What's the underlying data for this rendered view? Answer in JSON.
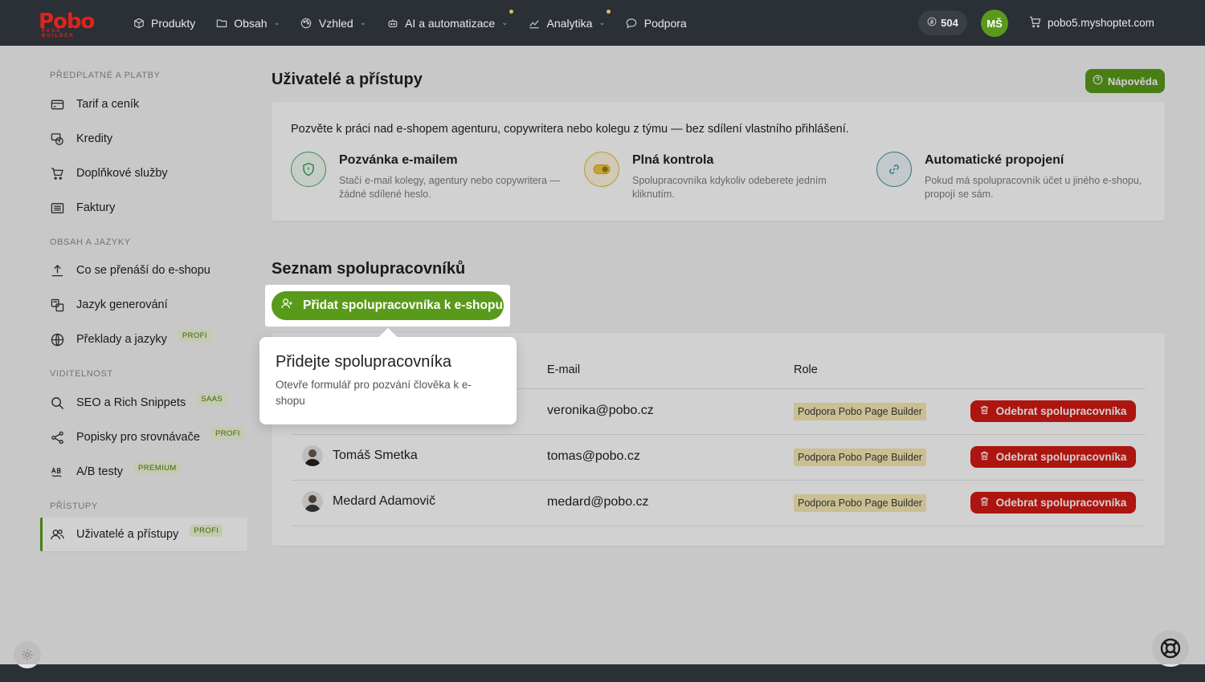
{
  "brand": {
    "logo_text": "Pobo",
    "logo_sub": "PAGE BUILDER"
  },
  "nav": {
    "items": [
      {
        "label": "Produkty",
        "icon": "box-icon"
      },
      {
        "label": "Obsah",
        "icon": "folder-icon"
      },
      {
        "label": "Vzhled",
        "icon": "palette-icon"
      },
      {
        "label": "AI a automatizace",
        "icon": "robot-icon"
      },
      {
        "label": "Analytika",
        "icon": "chart-icon"
      },
      {
        "label": "Podpora",
        "icon": "chat-icon"
      }
    ],
    "credits": "504",
    "user_initials": "MŠ",
    "shop": "pobo5.myshoptet.com"
  },
  "sidebar": {
    "sections": [
      {
        "title": "PŘEDPLATNÉ A PLATBY"
      },
      {
        "title": "OBSAH A JAZYKY"
      },
      {
        "title": "VIDITELNOST"
      },
      {
        "title": "PŘÍSTUPY"
      }
    ],
    "items": [
      {
        "label": "Tarif a ceník",
        "icon": "card-icon",
        "badge": ""
      },
      {
        "label": "Kredity",
        "icon": "coins-icon",
        "badge": ""
      },
      {
        "label": "Doplňkové služby",
        "icon": "cart-icon",
        "badge": ""
      },
      {
        "label": "Faktury",
        "icon": "invoice-icon",
        "badge": ""
      },
      {
        "label": "Co se přenáší do e-shopu",
        "icon": "upload-icon",
        "badge": ""
      },
      {
        "label": "Jazyk generování",
        "icon": "translate-icon",
        "badge": ""
      },
      {
        "label": "Překlady a jazyky",
        "icon": "globe-icon",
        "badge": "PROFI"
      },
      {
        "label": "SEO a Rich Snippets",
        "icon": "search-icon",
        "badge": "SAAS"
      },
      {
        "label": "Popisky pro srovnávače",
        "icon": "share-icon",
        "badge": "PROFI"
      },
      {
        "label": "A/B testy",
        "icon": "ab-icon",
        "badge": "PREMIUM"
      },
      {
        "label": "Uživatelé a přístupy",
        "icon": "users-icon",
        "badge": "PROFI"
      }
    ]
  },
  "main": {
    "title": "Uživatelé a přístupy",
    "help_label": "Nápověda",
    "info": {
      "lead": "Pozvěte k práci nad e-shopem agenturu, copywritera nebo kolegu z týmu — bez sdílení vlastního přihlášení.",
      "features": [
        {
          "title": "Pozvánka e-mailem",
          "desc": "Stačí e-mail kolegy, agentury nebo copywritera — žádné sdílené heslo."
        },
        {
          "title": "Plná kontrola",
          "desc": "Spolupracovníka kdykoliv odeberete jedním kliknutím."
        },
        {
          "title": "Automatické propojení",
          "desc": "Pokud má spolupracovník účet u jiného e-shopu, propojí se sám."
        }
      ]
    },
    "list_title": "Seznam spolupracovníků",
    "add_label": "Přidat spolupracovníka k e-shopu",
    "table": {
      "headers": {
        "email": "E-mail",
        "role": "Role"
      },
      "rows": [
        {
          "name": "",
          "email": "veronika@pobo.cz",
          "role": "Podpora Pobo Page Builder",
          "action": "Odebrat spolupracovníka"
        },
        {
          "name": "Tomáš Smetka",
          "email": "tomas@pobo.cz",
          "role": "Podpora Pobo Page Builder",
          "action": "Odebrat spolupracovníka"
        },
        {
          "name": "Medard Adamovič",
          "email": "medard@pobo.cz",
          "role": "Podpora Pobo Page Builder",
          "action": "Odebrat spolupracovníka"
        }
      ]
    }
  },
  "tooltip": {
    "title": "Přidejte spolupracovníka",
    "desc": "Otevře formulář pro pozvání člověka k e-shopu"
  },
  "colors": {
    "brand_green": "#5a9a1a",
    "danger_red": "#d41a14",
    "logo_red": "#e0231b",
    "topbar": "#2b2f36"
  }
}
